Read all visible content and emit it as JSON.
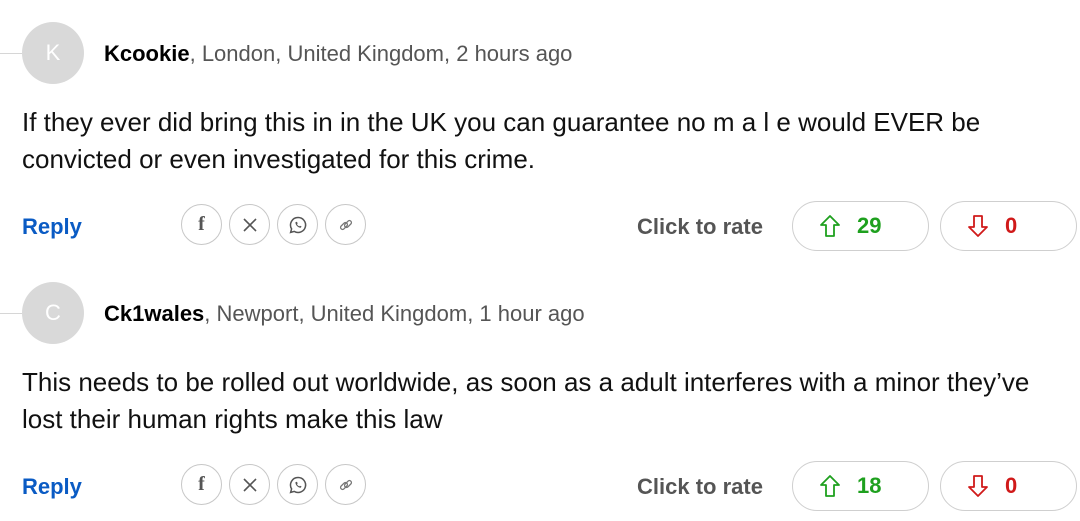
{
  "colors": {
    "reply": "#0a5bc4",
    "upvote": "#1ea01e",
    "downvote": "#d01a1a",
    "avatar": "#d9d9d9"
  },
  "share_icons": [
    "facebook-icon",
    "x-icon",
    "whatsapp-icon",
    "link-icon"
  ],
  "comments": [
    {
      "avatar_initial": "K",
      "username": "Kcookie",
      "meta": ", London, United Kingdom, 2 hours ago",
      "text": "If they ever did bring this in in the UK you can guarantee no m a l e would EVER be convicted or even investigated for this crime.",
      "reply_label": "Reply",
      "rate_label": "Click to rate",
      "upvotes": "29",
      "downvotes": "0"
    },
    {
      "avatar_initial": "C",
      "username": "Ck1wales",
      "meta": ", Newport, United Kingdom, 1 hour ago",
      "text": "This needs to be rolled out worldwide, as soon as a adult interferes with a minor they’ve lost their human rights make this law",
      "reply_label": "Reply",
      "rate_label": "Click to rate",
      "upvotes": "18",
      "downvotes": "0"
    }
  ]
}
